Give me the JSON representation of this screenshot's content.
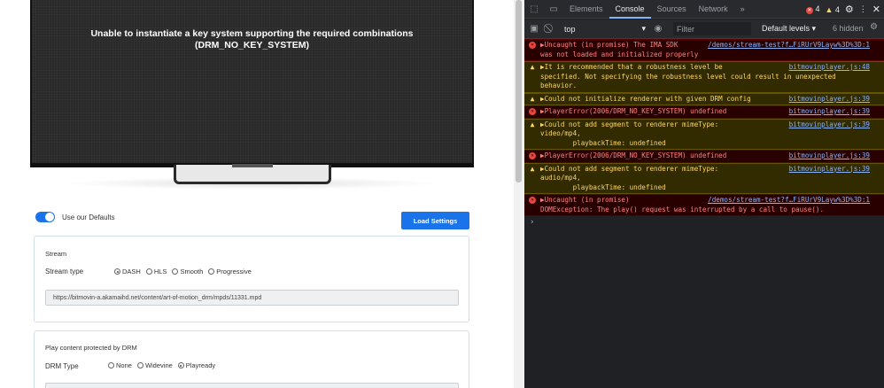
{
  "player": {
    "error_line1": "Unable to instantiate a key system supporting the required combinations",
    "error_line2": "(DRM_NO_KEY_SYSTEM)"
  },
  "settings": {
    "use_defaults_label": "Use our Defaults",
    "use_defaults_on": true,
    "load_button": "Load Settings",
    "accent_color": "#1a73e8"
  },
  "stream": {
    "title": "Stream",
    "type_label": "Stream type",
    "options": [
      "DASH",
      "HLS",
      "Smooth",
      "Progressive"
    ],
    "selected": "DASH",
    "url": "https://bitmovin-a.akamaihd.net/content/art-of-motion_drm/mpds/11331.mpd"
  },
  "drm": {
    "title": "Play content protected by DRM",
    "type_label": "DRM Type",
    "options": [
      "None",
      "Widevine",
      "Playready"
    ],
    "selected": "Playready"
  },
  "devtools": {
    "tabs": [
      "Elements",
      "Console",
      "Sources",
      "Network"
    ],
    "active_tab": "Console",
    "more_tabs": "»",
    "error_count": "4",
    "warning_count": "4",
    "context": "top",
    "filter_placeholder": "Filter",
    "levels": "Default levels ▾",
    "hidden": "6 hidden",
    "messages": [
      {
        "level": "error",
        "text": "▶Uncaught (in promise) The IMA SDK \nwas not loaded and initialized properly",
        "source": "/demos/stream-test?f…FiRUrV9Layw%3D%3D:1"
      },
      {
        "level": "warning",
        "text": "▶It is recommended that a robustness level be \nspecified. Not specifying the robustness level could result in unexpected\nbehavior.",
        "source": "bitmovinplayer.js:48"
      },
      {
        "level": "warning",
        "text": "▶Could not initialize renderer with given DRM config",
        "source": "bitmovinplayer.js:39"
      },
      {
        "level": "error",
        "text": "▶PlayerError(2006/DRM_NO_KEY_SYSTEM) undefined",
        "source": "bitmovinplayer.js:39"
      },
      {
        "level": "warning",
        "text": "▶Could not add segment to renderer mimeType:\nvideo/mp4,\n        playbackTime: undefined",
        "source": "bitmovinplayer.js:39"
      },
      {
        "level": "error",
        "text": "▶PlayerError(2006/DRM_NO_KEY_SYSTEM) undefined",
        "source": "bitmovinplayer.js:39"
      },
      {
        "level": "warning",
        "text": "▶Could not add segment to renderer mimeType:\naudio/mp4,\n        playbackTime: undefined",
        "source": "bitmovinplayer.js:39"
      },
      {
        "level": "error",
        "text": "▶Uncaught (in promise)\nDOMException: The play() request was interrupted by a call to pause().",
        "source": "/demos/stream-test?f…FiRUrV9Layw%3D%3D:1"
      }
    ],
    "prompt": "›"
  }
}
